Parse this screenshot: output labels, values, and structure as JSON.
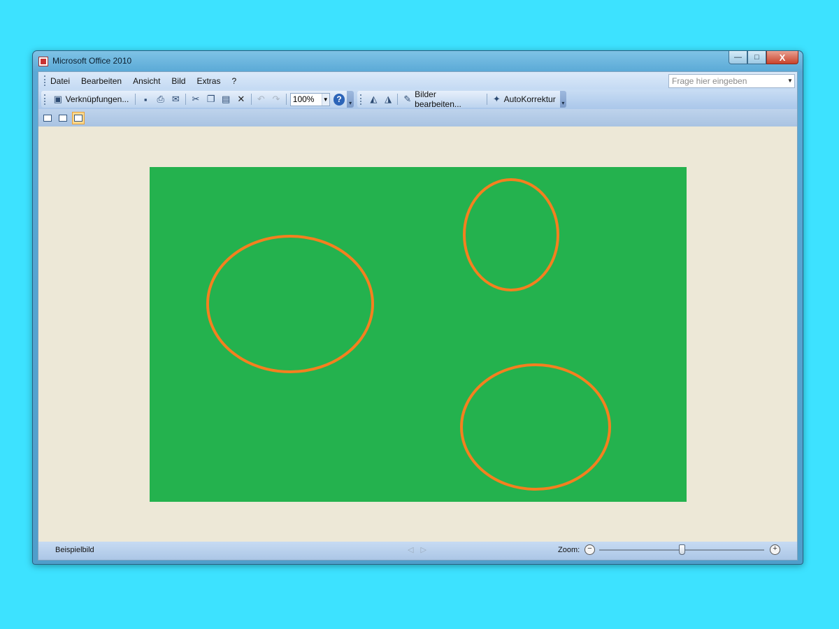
{
  "window": {
    "title": "Microsoft Office 2010"
  },
  "title_buttons": {
    "minimize": "—",
    "maximize": "□",
    "close": "X"
  },
  "menu": {
    "items": [
      "Datei",
      "Bearbeiten",
      "Ansicht",
      "Bild",
      "Extras",
      "?"
    ],
    "ask_placeholder": "Frage hier eingeben"
  },
  "toolbar": {
    "links_label": "Verknüpfungen...",
    "zoom_value": "100%",
    "help": "?",
    "edit_pictures_label": "Bilder bearbeiten...",
    "autocorrect_label": "AutoKorrektur"
  },
  "picture": {
    "background_color": "#24b24e",
    "ellipse_color": "#f4801f"
  },
  "statusbar": {
    "filename": "Beispielbild",
    "zoom_label": "Zoom:",
    "zoom_out": "−",
    "zoom_in": "+",
    "zoom_slider_level": 0.5
  },
  "icons": {
    "app": "office-picture-manager-icon",
    "save": "save-icon",
    "print": "print-icon",
    "email": "email-icon",
    "cut": "cut-icon",
    "copy": "copy-icon",
    "paste": "paste-icon",
    "delete": "delete-icon",
    "undo": "undo-icon",
    "redo": "redo-icon",
    "rotate_left": "rotate-left-icon",
    "rotate_right": "rotate-right-icon",
    "edit_pictures": "edit-pictures-icon",
    "autocorrect": "autocorrect-icon"
  }
}
